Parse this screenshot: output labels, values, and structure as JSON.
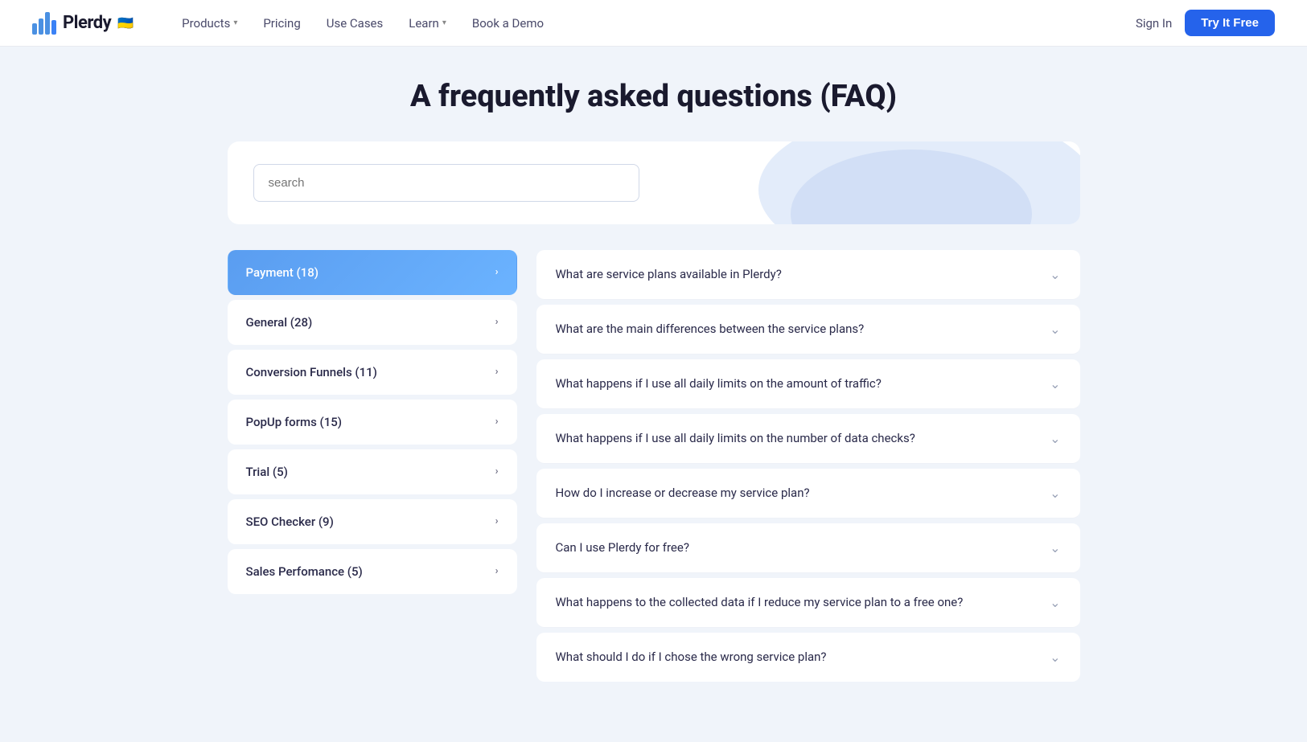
{
  "navbar": {
    "logo_text": "Plerdy",
    "flag": "🇺🇦",
    "nav_links": [
      {
        "id": "products",
        "label": "Products",
        "has_dropdown": true
      },
      {
        "id": "pricing",
        "label": "Pricing",
        "has_dropdown": false
      },
      {
        "id": "use-cases",
        "label": "Use Cases",
        "has_dropdown": false
      },
      {
        "id": "learn",
        "label": "Learn",
        "has_dropdown": true
      },
      {
        "id": "book-demo",
        "label": "Book a Demo",
        "has_dropdown": false
      }
    ],
    "sign_in": "Sign In",
    "try_free": "Try It Free"
  },
  "page": {
    "title": "A frequently asked questions (FAQ)",
    "search_placeholder": "search"
  },
  "sidebar": {
    "items": [
      {
        "id": "payment",
        "label": "Payment (18)",
        "active": true
      },
      {
        "id": "general",
        "label": "General (28)",
        "active": false
      },
      {
        "id": "conversion-funnels",
        "label": "Conversion Funnels (11)",
        "active": false
      },
      {
        "id": "popup-forms",
        "label": "PopUp forms (15)",
        "active": false
      },
      {
        "id": "trial",
        "label": "Trial (5)",
        "active": false
      },
      {
        "id": "seo-checker",
        "label": "SEO Checker (9)",
        "active": false
      },
      {
        "id": "sales-performance",
        "label": "Sales Perfomance (5)",
        "active": false
      }
    ]
  },
  "faq": {
    "questions": [
      {
        "id": "q1",
        "text": "What are service plans available in Plerdy?"
      },
      {
        "id": "q2",
        "text": "What are the main differences between the service plans?"
      },
      {
        "id": "q3",
        "text": "What happens if I use all daily limits on the amount of traffic?"
      },
      {
        "id": "q4",
        "text": "What happens if I use all daily limits on the number of data checks?"
      },
      {
        "id": "q5",
        "text": "How do I increase or decrease my service plan?"
      },
      {
        "id": "q6",
        "text": "Can I use Plerdy for free?"
      },
      {
        "id": "q7",
        "text": "What happens to the collected data if I reduce my service plan to a free one?"
      },
      {
        "id": "q8",
        "text": "What should I do if I chose the wrong service plan?"
      }
    ]
  },
  "icons": {
    "chevron_down": "∨",
    "chevron_right": "›"
  }
}
